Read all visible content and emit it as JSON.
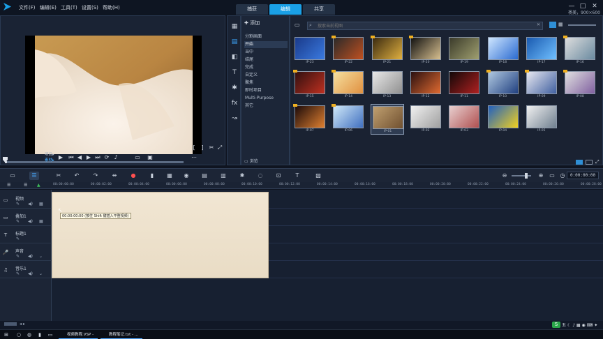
{
  "menu": {
    "items": [
      "文件(F)",
      "编辑(E)",
      "工具(T)",
      "设置(S)",
      "帮助(H)"
    ]
  },
  "modes": {
    "tabs": [
      "捕获",
      "编辑",
      "共享"
    ],
    "active": "编辑"
  },
  "user_info": "杨美，900×600",
  "player": {
    "mini_labels": {
      "project": "项目▸",
      "clip": "素材▸"
    }
  },
  "library": {
    "add_label": "添加",
    "categories": [
      "分割画面",
      "开始",
      "当中",
      "结尾",
      "完成",
      "自定义",
      "聚焦",
      "即时项目",
      "Multi-Purpose",
      "其它"
    ],
    "active_category": "开始",
    "browse_label": "浏览",
    "search_placeholder": "搜索当前视图",
    "thumbs": [
      {
        "cap": "IP-23"
      },
      {
        "cap": "IP-22"
      },
      {
        "cap": "IP-21"
      },
      {
        "cap": "IP-20"
      },
      {
        "cap": "IP-19"
      },
      {
        "cap": "IP-18"
      },
      {
        "cap": "IP-17"
      },
      {
        "cap": "IP-16"
      },
      {
        "cap": "IP-15"
      },
      {
        "cap": "IP-14"
      },
      {
        "cap": "IP-13"
      },
      {
        "cap": "IP-12"
      },
      {
        "cap": "IP-11"
      },
      {
        "cap": "IP-10"
      },
      {
        "cap": "IP-09"
      },
      {
        "cap": "IP-08"
      },
      {
        "cap": "IP-07"
      },
      {
        "cap": "IP-06"
      },
      {
        "cap": "IP-01"
      },
      {
        "cap": "IP-02"
      },
      {
        "cap": "IP-03"
      },
      {
        "cap": "IP-04"
      },
      {
        "cap": "IP-05"
      }
    ]
  },
  "timeline": {
    "timecode": "0:00:00:00",
    "ruler_ticks": [
      "00:00:00:00",
      "00:00:02:00",
      "00:00:04:00",
      "00:00:06:00",
      "00:00:08:00",
      "00:00:10:00",
      "00:00:12:00",
      "00:00:14:00",
      "00:00:16:00",
      "00:00:18:00",
      "00:00:20:00",
      "00:00:22:00",
      "00:00:24:00",
      "00:00:26:00",
      "00:00:28:00"
    ],
    "tracks": [
      "视频",
      "叠加1",
      "标题1",
      "声音",
      "音乐1"
    ],
    "tooltip": "00:00:00:00 (按住 Shift 键插入平整视频)"
  },
  "taskbar": {
    "apps": [
      "视频教程.VSP - ...",
      "教程笔记.txt - ..."
    ]
  },
  "colors": {
    "accent": "#1aa0e6",
    "clip": "#efe3cf"
  }
}
